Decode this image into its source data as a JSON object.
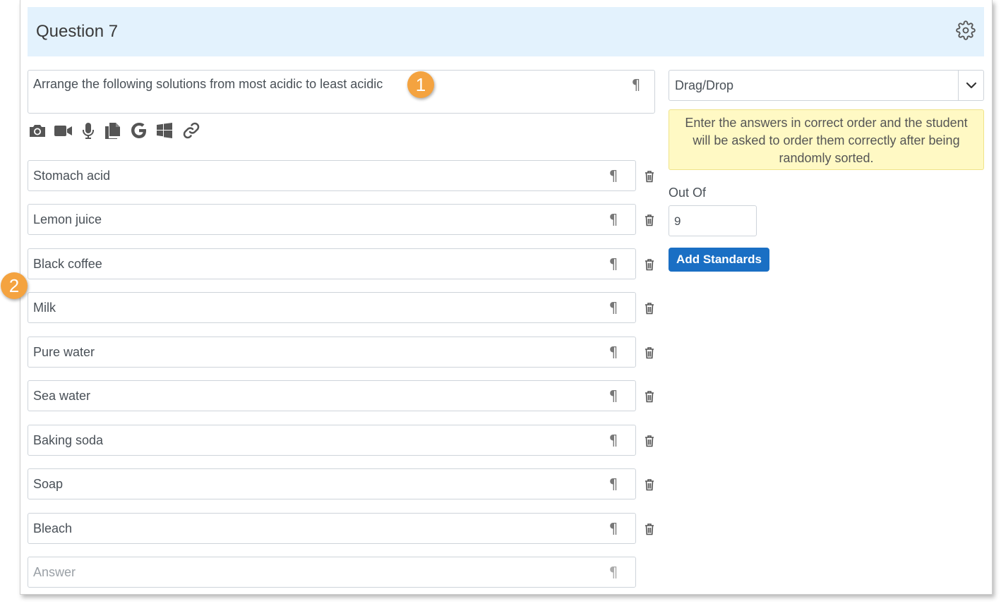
{
  "header": {
    "title": "Question 7"
  },
  "question": {
    "text": "Arrange the following solutions from most acidic to least acidic"
  },
  "pilcrow": "¶",
  "toolbar": [
    "camera-icon",
    "video-icon",
    "microphone-icon",
    "files-icon",
    "google-icon",
    "windows-icon",
    "link-icon"
  ],
  "answers": [
    "Stomach acid",
    "Lemon juice",
    "Black coffee",
    "Milk",
    "Pure water",
    "Sea water",
    "Baking soda",
    "Soap",
    "Bleach"
  ],
  "new_answer": {
    "placeholder": "Answer"
  },
  "question_type": {
    "selected": "Drag/Drop"
  },
  "info": "Enter the answers in correct order and the student will be asked to order them correctly after being randomly sorted.",
  "out_of": {
    "label": "Out Of",
    "value": "9"
  },
  "add_standards": "Add Standards",
  "callouts": [
    "1",
    "2"
  ],
  "colors": {
    "header_bg": "#e3f2fd",
    "button": "#1a6fc4",
    "info_bg": "#fff9c4",
    "callout": "#f4a340"
  }
}
